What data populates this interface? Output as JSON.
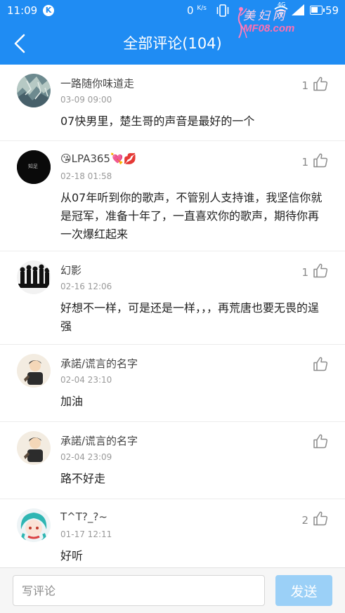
{
  "status_bar": {
    "time": "11:09",
    "k_badge": "K",
    "net_speed": "0",
    "net_speed_unit": "K/s",
    "battery_level": "59",
    "network_label": "4G"
  },
  "watermark": {
    "cn": "美妇网",
    "en": "MF08.com"
  },
  "header": {
    "title": "全部评论(104)"
  },
  "colors": {
    "accent": "#1f8cf3",
    "send_disabled": "#9bd0f7"
  },
  "comments": [
    {
      "name": "一路随你味道走",
      "time": "03-09 09:00",
      "content": "07快男里，楚生哥的声音是最好的一个",
      "likes": "1",
      "avatar_icon": "textured-avatar"
    },
    {
      "name": "LPA365",
      "emoji_prefix": "😘",
      "emoji_suffix": "💘💋",
      "time": "02-18 01:58",
      "content": "从07年听到你的歌声，不管别人支持谁，我坚信你就是冠军，准备十年了，一直喜欢你的歌声，期待你再一次爆红起来",
      "likes": "1",
      "avatar_text": "知足",
      "avatar_icon": "black-circle-avatar"
    },
    {
      "name": "幻影",
      "time": "02-16 12:06",
      "content": "好想不一样，可是还是一样，，，再荒唐也要无畏的逞强",
      "likes": "1",
      "avatar_icon": "crowd-silhouette-avatar"
    },
    {
      "name": "承諾/谎言的名字",
      "time": "02-04 23:10",
      "content": "加油",
      "likes": "",
      "avatar_icon": "cartoon-person-avatar"
    },
    {
      "name": "承諾/谎言的名字",
      "time": "02-04 23:09",
      "content": "路不好走",
      "likes": "",
      "avatar_icon": "cartoon-person-avatar"
    },
    {
      "name": "T^T?_?~",
      "time": "01-17 12:11",
      "content": "好听",
      "likes": "2",
      "avatar_icon": "anime-girl-avatar"
    }
  ],
  "bottom_bar": {
    "input_placeholder": "写评论",
    "send_label": "发送"
  }
}
